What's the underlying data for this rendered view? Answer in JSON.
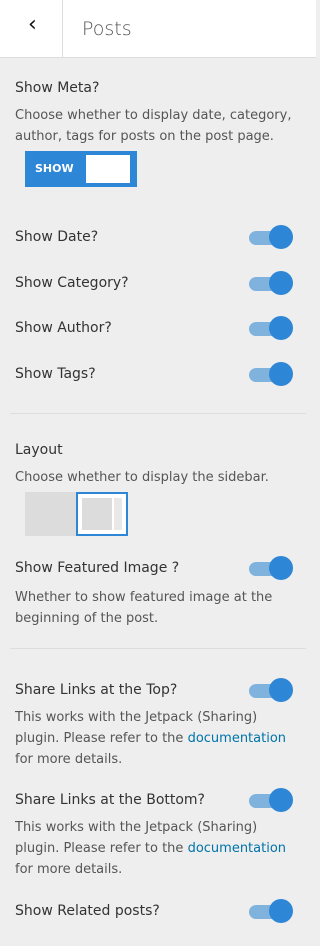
{
  "header": {
    "back_icon": "back-arrow-icon",
    "title": "Posts"
  },
  "meta": {
    "label": "Show Meta?",
    "description": "Choose whether to display date, category, author, tags for posts on the post page.",
    "toggle_label": "SHOW"
  },
  "toggles": [
    {
      "label": "Show Date?",
      "on": true
    },
    {
      "label": "Show Category?",
      "on": true
    },
    {
      "label": "Show Author?",
      "on": true
    },
    {
      "label": "Show Tags?",
      "on": true
    }
  ],
  "layout": {
    "label": "Layout",
    "description": "Choose whether to display the sidebar."
  },
  "featured": {
    "label": "Show Featured Image ?",
    "description": "Whether to show featured image at the beginning of the post.",
    "on": true
  },
  "share_top": {
    "label": "Share Links at the Top?",
    "description_prefix": "This works with the Jetpack (Sharing) plugin. Please refer to the ",
    "link_text": "documentation",
    "description_suffix": " for more details.",
    "on": true
  },
  "share_bottom": {
    "label": "Share Links at the Bottom?",
    "description_prefix": "This works with the Jetpack (Sharing) plugin. Please refer to the ",
    "link_text": "documentation",
    "description_suffix": " for more details.",
    "on": true
  },
  "related": {
    "label": "Show Related posts?",
    "on": true
  },
  "colors": {
    "accent": "#2d86d6",
    "background": "#eeeeee"
  }
}
